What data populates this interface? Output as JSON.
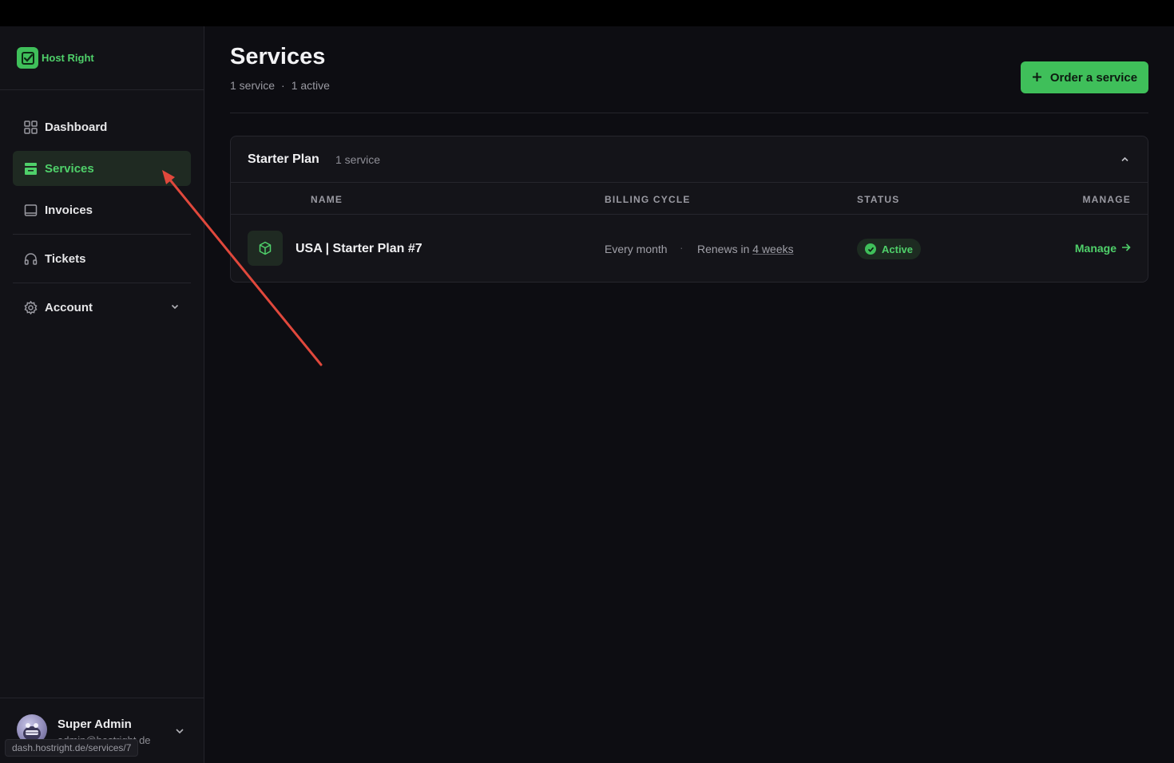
{
  "app": {
    "brand": "Host Right"
  },
  "sidebar": {
    "items": [
      {
        "label": "Dashboard",
        "icon": "grid-icon"
      },
      {
        "label": "Services",
        "icon": "server-icon",
        "active": true
      },
      {
        "label": "Invoices",
        "icon": "invoice-icon"
      },
      {
        "label": "Tickets",
        "icon": "headset-icon"
      },
      {
        "label": "Account",
        "icon": "gear-icon",
        "expandable": true
      }
    ]
  },
  "user": {
    "name": "Super Admin",
    "email": "admin@hostright.de"
  },
  "status_bar": {
    "url": "dash.hostright.de/services/7"
  },
  "page": {
    "title": "Services",
    "service_count": "1 service",
    "dot": "·",
    "active_count": "1 active",
    "order_button": "Order a service"
  },
  "group": {
    "title": "Starter Plan",
    "count": "1 service",
    "columns": [
      "NAME",
      "BILLING CYCLE",
      "STATUS",
      "MANAGE"
    ],
    "rows": [
      {
        "name": "USA | Starter Plan #7",
        "cycle": "Every month",
        "separator": "·",
        "renews_prefix": "Renews in ",
        "renews_value": "4 weeks",
        "status": "Active",
        "manage": "Manage"
      }
    ]
  },
  "colors": {
    "accent": "#3fbf5a",
    "accent_text": "#4fd06a",
    "background": "#0d0d12",
    "sidebar": "#121217",
    "annotation_arrow": "#e0483c"
  }
}
